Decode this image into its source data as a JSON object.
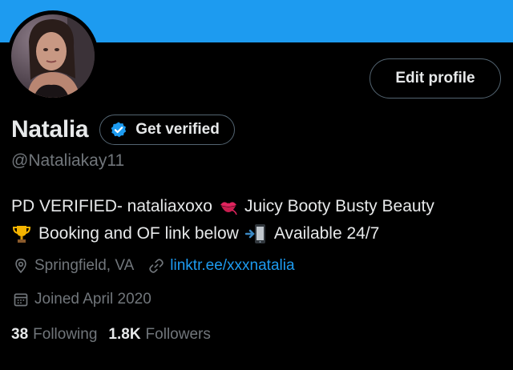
{
  "colors": {
    "banner": "#1d9bf0",
    "background": "#000000",
    "text_primary": "#e7e9ea",
    "text_secondary": "#71767b",
    "link": "#1d9bf0",
    "verified_badge": "#1d9bf0"
  },
  "profile": {
    "edit_profile_label": "Edit profile",
    "display_name": "Natalia",
    "get_verified_label": "Get verified",
    "handle": "@Nataliakay11",
    "bio": {
      "line1_part1": "PD VERIFIED- nataliaxoxo",
      "line1_emoji": "kiss-mark-icon",
      "line1_part2": "Juicy Booty Busty Beauty",
      "line2_emoji1": "trophy-icon",
      "line2_part1": "Booking and OF link below",
      "line2_emoji2": "mobile-phone-arrow-icon",
      "line2_part2": "Available 24/7"
    },
    "location": "Springfield, VA",
    "website": "linktr.ee/xxxnatalia",
    "joined": "Joined April 2020",
    "following_count": "38",
    "following_label": "Following",
    "followers_count": "1.8K",
    "followers_label": "Followers"
  }
}
